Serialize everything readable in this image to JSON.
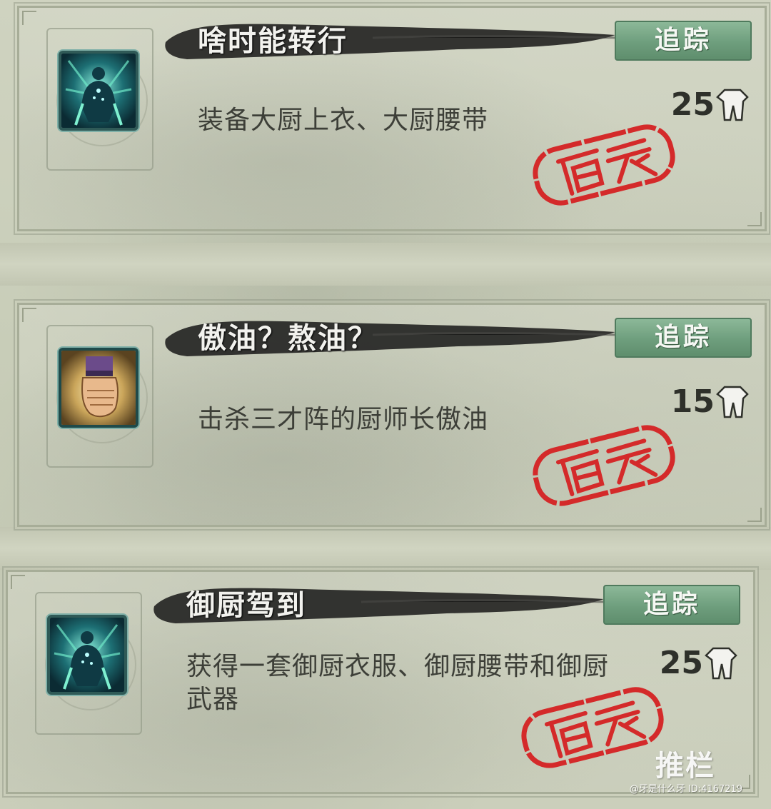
{
  "achievements": [
    {
      "title": "啥时能转行",
      "track_label": "追踪",
      "description": "装备大厨上衣、大厨腰带",
      "points": "25",
      "icon": "meditating-figure-icon",
      "stamp_text": "完成"
    },
    {
      "title": "傲油？熬油？",
      "track_label": "追踪",
      "description": "击杀三才阵的厨师长傲油",
      "points": "15",
      "icon": "clenched-fist-icon",
      "stamp_text": "完成"
    },
    {
      "title": "御厨驾到",
      "track_label": "追踪",
      "description": "获得一套御厨衣服、御厨腰带和御厨武器",
      "points": "25",
      "icon": "meditating-figure-icon",
      "stamp_text": "完成"
    }
  ],
  "watermark": {
    "brand": "推栏",
    "credit": "@牙是什么牙 ID:4167219"
  },
  "colors": {
    "parchment": "#c9cdb9",
    "track_button": "#6e9e7d",
    "stamp_red": "#d42a2a",
    "ink": "#2a2a28"
  }
}
